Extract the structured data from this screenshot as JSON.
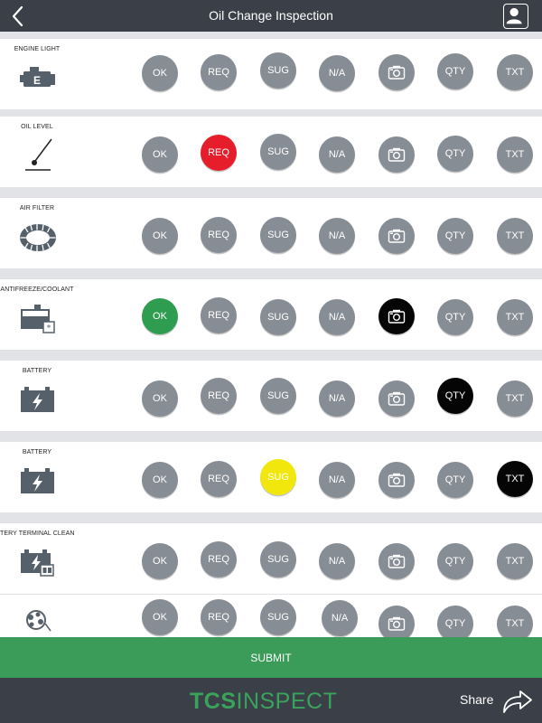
{
  "header": {
    "title": "Oil Change Inspection"
  },
  "buttons": {
    "ok": "OK",
    "req": "REQ",
    "sug": "SUG",
    "na": "N/A",
    "qty": "QTY",
    "txt": "TXT",
    "camera_icon": "camera-icon"
  },
  "rows": [
    {
      "label": "ENGINE LIGHT",
      "icon": "engine-icon",
      "selected": []
    },
    {
      "label": "OIL LEVEL",
      "icon": "oil-dipstick-icon",
      "selected": [
        "REQ"
      ]
    },
    {
      "label": "AIR FILTER",
      "icon": "air-filter-icon",
      "selected": []
    },
    {
      "label": "ANTIFREEZE/COOLANT",
      "icon": "coolant-icon",
      "selected": [
        "OK",
        "PHOTO"
      ]
    },
    {
      "label": "BATTERY",
      "icon": "battery-icon",
      "selected": [
        "QTY"
      ]
    },
    {
      "label": "BATTERY",
      "icon": "battery-icon",
      "selected": [
        "SUG",
        "TXT"
      ]
    },
    {
      "label": "TERY TERMINAL CLEANING",
      "icon": "battery-terminal-icon",
      "selected": []
    },
    {
      "label": "",
      "icon": "parts-icon",
      "selected": []
    }
  ],
  "colors": {
    "req_selected": "#e61e2b",
    "ok_selected": "#2f9d4f",
    "sug_selected": "#f2e70c",
    "active_selected": "#050505",
    "unselected": "#878d94",
    "submit": "#3a9c58",
    "bars": "#3b3f48"
  },
  "submit_label": "SUBMIT",
  "footer": {
    "logo_bold": "TCS",
    "logo_light": "INSPECT",
    "share_label": "Share"
  }
}
